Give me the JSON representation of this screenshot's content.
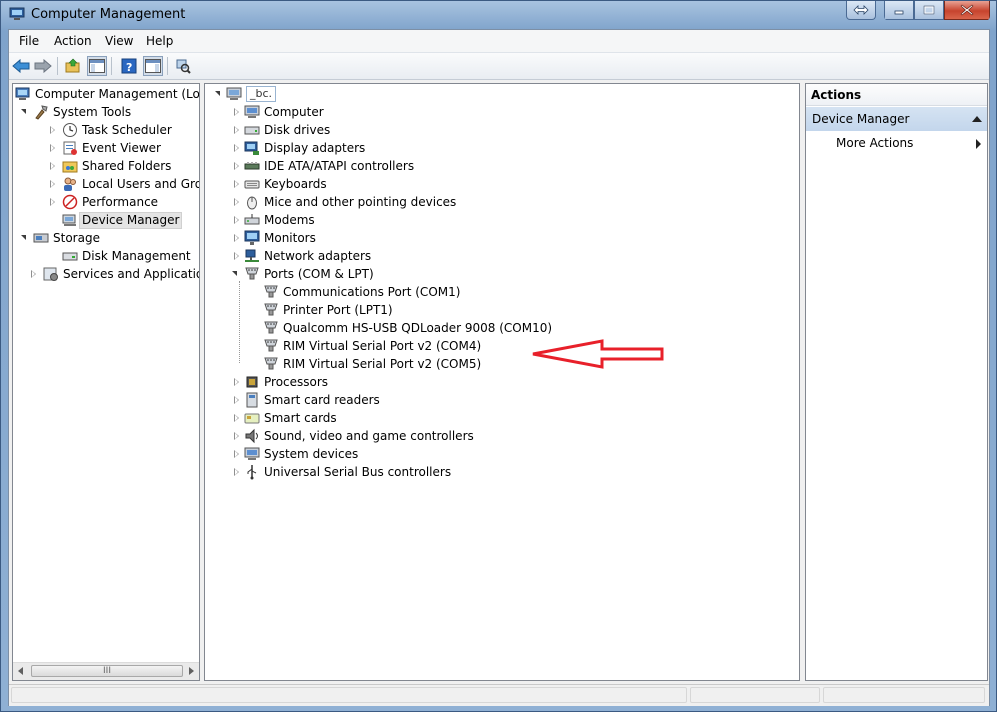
{
  "window": {
    "title": "Computer Management"
  },
  "menu": [
    "File",
    "Action",
    "View",
    "Help"
  ],
  "left_tree": {
    "root": "Computer Management (Local",
    "system_tools": "System Tools",
    "system_items": [
      "Task Scheduler",
      "Event Viewer",
      "Shared Folders",
      "Local Users and Groups",
      "Performance",
      "Device Manager"
    ],
    "storage": "Storage",
    "storage_items": [
      "Disk Management"
    ],
    "services": "Services and Applications",
    "scroll_grip": "III"
  },
  "device_tree": {
    "root": "_bc.",
    "categories_before": [
      "Computer",
      "Disk drives",
      "Display adapters",
      "IDE ATA/ATAPI controllers",
      "Keyboards",
      "Mice and other pointing devices",
      "Modems",
      "Monitors",
      "Network adapters"
    ],
    "ports": "Ports (COM & LPT)",
    "port_items": [
      "Communications Port (COM1)",
      "Printer Port (LPT1)",
      "Qualcomm HS-USB QDLoader 9008 (COM10)",
      "RIM Virtual Serial Port v2 (COM4)",
      "RIM Virtual Serial Port v2 (COM5)"
    ],
    "categories_after": [
      "Processors",
      "Smart card readers",
      "Smart cards",
      "Sound, video and game controllers",
      "System devices",
      "Universal Serial Bus controllers"
    ]
  },
  "actions": {
    "header": "Actions",
    "section": "Device Manager",
    "items": [
      "More Actions"
    ]
  },
  "annotation": {
    "color": "#e8202a"
  }
}
